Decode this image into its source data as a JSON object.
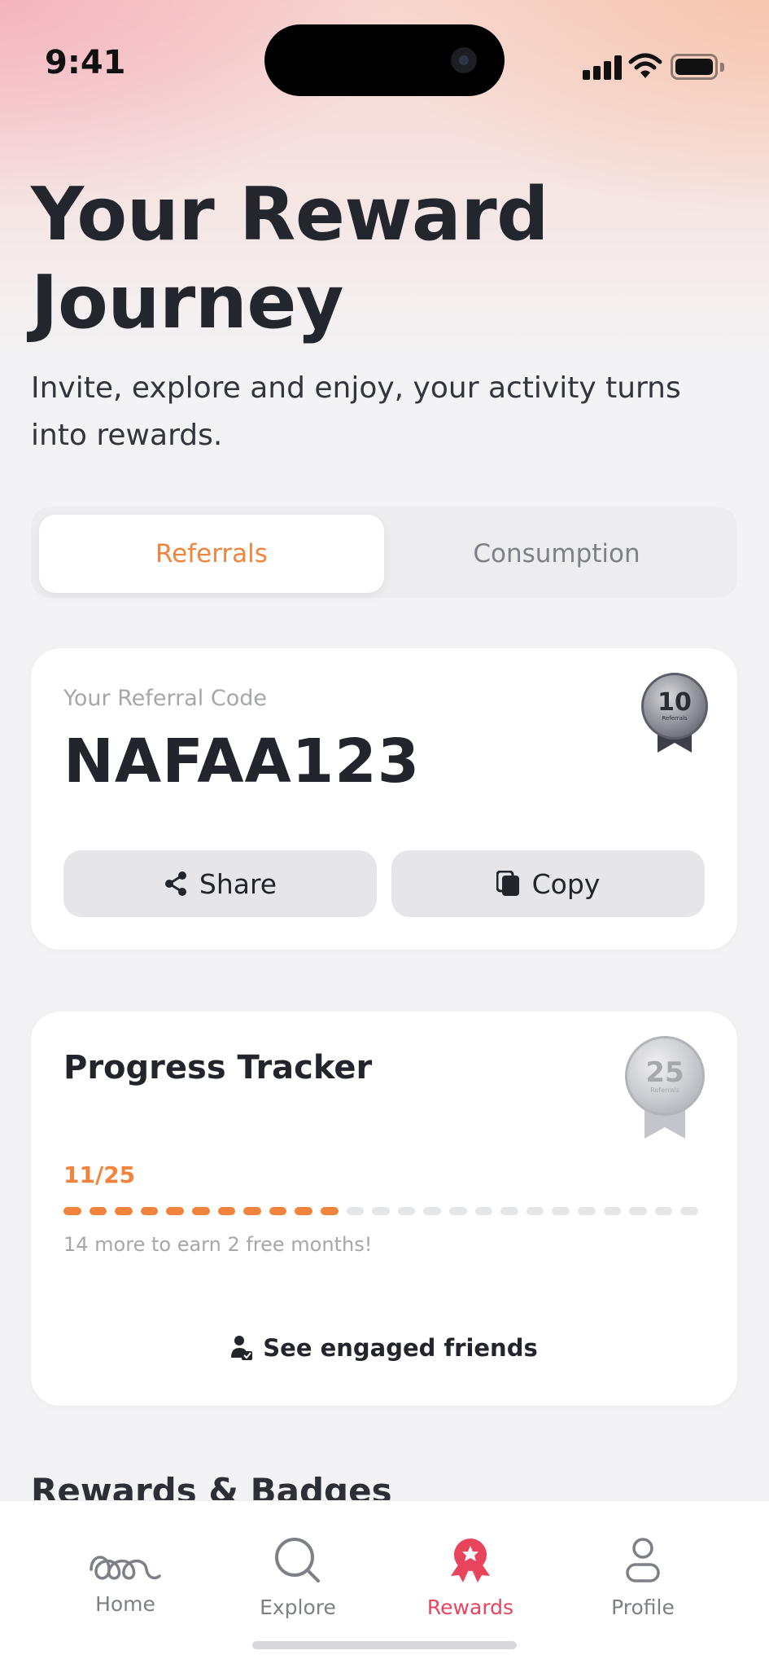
{
  "status_bar": {
    "time": "9:41"
  },
  "header": {
    "title": "Your Reward Journey",
    "subtitle": "Invite, explore and enjoy, your activity turns into rewards."
  },
  "tabs": [
    {
      "label": "Referrals",
      "active": true
    },
    {
      "label": "Consumption",
      "active": false
    }
  ],
  "referral_card": {
    "label": "Your Referral Code",
    "code": "NAFAA123",
    "badge": {
      "number": "10",
      "caption": "Referrals"
    },
    "share_label": "Share",
    "copy_label": "Copy"
  },
  "progress_card": {
    "title": "Progress Tracker",
    "count_text": "11/25",
    "current": 11,
    "total": 25,
    "hint": "14 more to earn 2 free months!",
    "badge": {
      "number": "25",
      "caption": "Referrals"
    },
    "friends_label": "See engaged friends"
  },
  "section": {
    "title": "Rewards & Badges"
  },
  "bottom_nav": [
    {
      "label": "Home",
      "icon": "home-icon",
      "active": false
    },
    {
      "label": "Explore",
      "icon": "search-icon",
      "active": false
    },
    {
      "label": "Rewards",
      "icon": "rewards-icon",
      "active": true
    },
    {
      "label": "Profile",
      "icon": "profile-icon",
      "active": false
    }
  ],
  "colors": {
    "accent_orange": "#f1843c",
    "accent_red": "#e8455d",
    "text_dark": "#24262e",
    "muted": "#a5a7ad"
  }
}
